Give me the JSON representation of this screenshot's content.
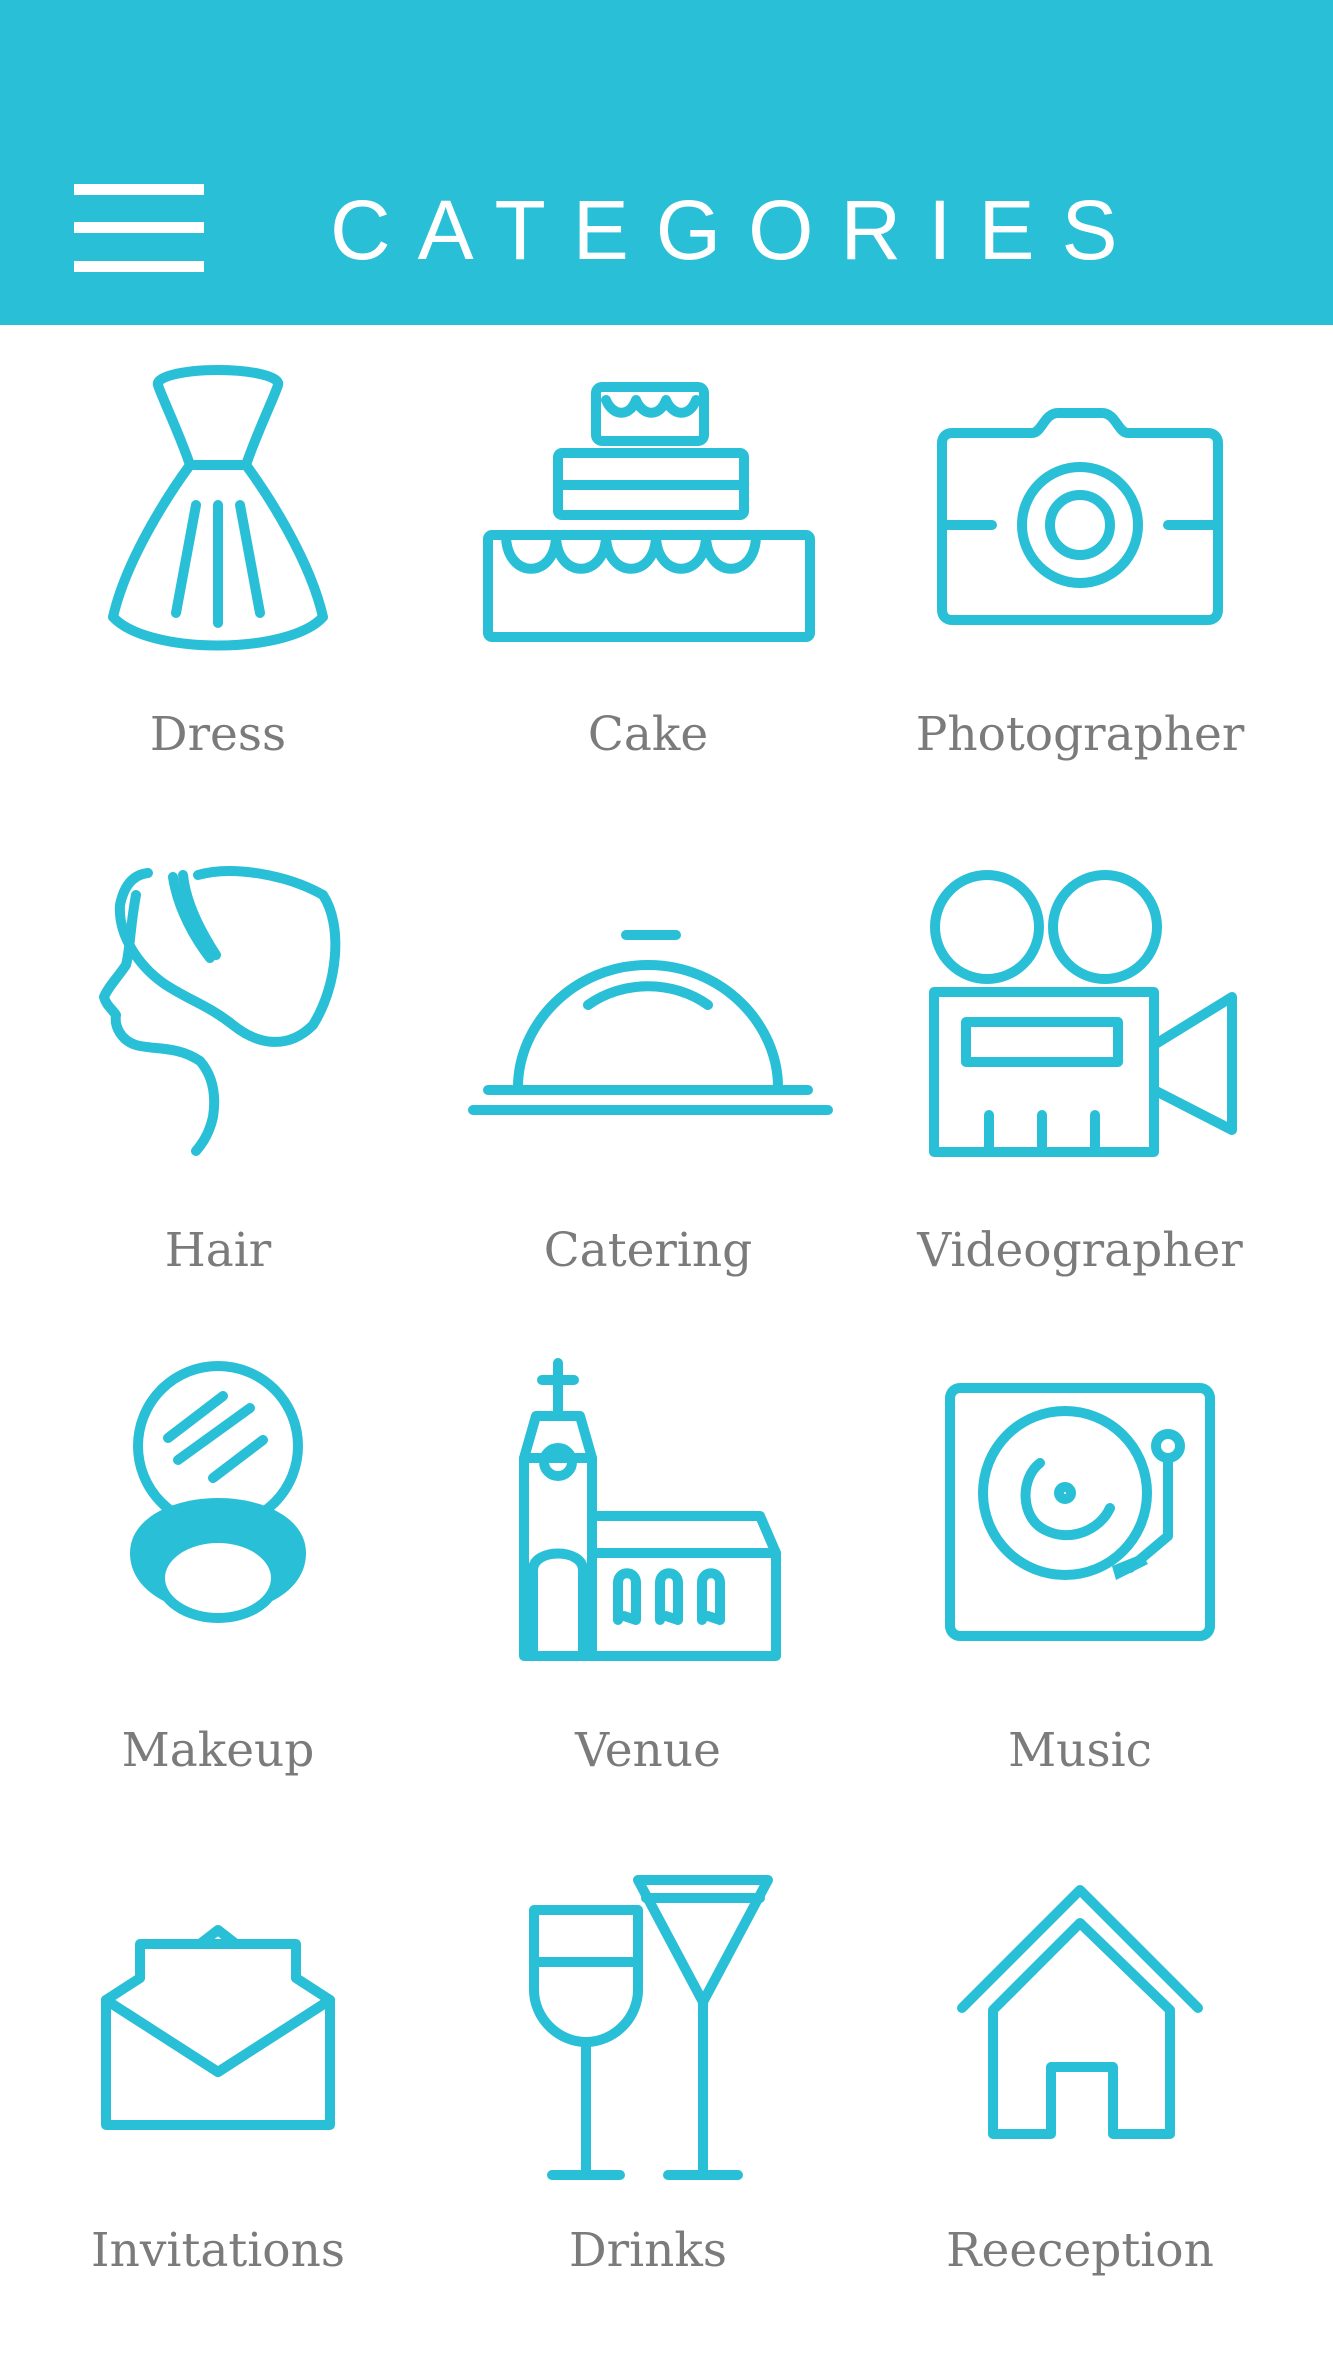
{
  "header": {
    "title": "CATEGORIES",
    "menu_icon": "hamburger-menu-icon",
    "background_color": "#29BFD6"
  },
  "colors": {
    "accent": "#29BFD6",
    "label_text": "#7b7b7b",
    "header_text": "#ffffff"
  },
  "categories": [
    {
      "label": "Dress",
      "icon": "dress-icon"
    },
    {
      "label": "Cake",
      "icon": "cake-icon"
    },
    {
      "label": "Photographer",
      "icon": "camera-icon"
    },
    {
      "label": "Hair",
      "icon": "hair-icon"
    },
    {
      "label": "Catering",
      "icon": "cloche-icon"
    },
    {
      "label": "Videographer",
      "icon": "video-camera-icon"
    },
    {
      "label": "Makeup",
      "icon": "compact-mirror-icon"
    },
    {
      "label": "Venue",
      "icon": "church-icon"
    },
    {
      "label": "Music",
      "icon": "turntable-icon"
    },
    {
      "label": "Invitations",
      "icon": "envelope-icon"
    },
    {
      "label": "Drinks",
      "icon": "glasses-icon"
    },
    {
      "label": "Reeception",
      "icon": "house-icon"
    }
  ]
}
